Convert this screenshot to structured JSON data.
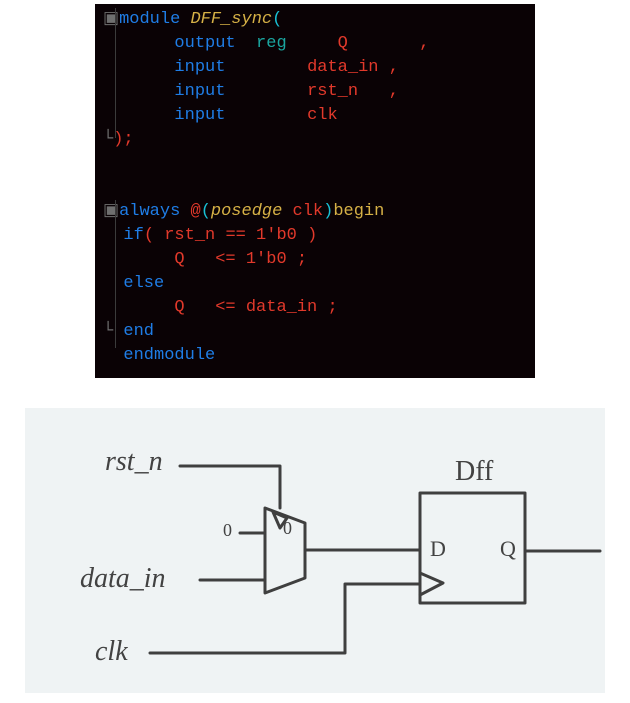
{
  "code": {
    "l1": {
      "kw": "module ",
      "name": "DFF_sync",
      "open": "("
    },
    "l2": {
      "dir": "output  ",
      "type": "reg",
      "sig": "Q",
      "comma": ","
    },
    "l3": {
      "dir": "input",
      "sig": "data_in ",
      "comma": ","
    },
    "l4": {
      "dir": "input",
      "sig": "rst_n",
      "comma": ","
    },
    "l5": {
      "dir": "input",
      "sig": "clk"
    },
    "l6": {
      "close": ");"
    },
    "l7": "",
    "l8": "",
    "l9": {
      "kw": "always ",
      "at": "@",
      "open": "(",
      "edge": "posedge ",
      "sig": "clk",
      "close": ")",
      "begin": "begin"
    },
    "l10": {
      "kw": "if",
      "open": "( ",
      "sig": "rst_n ",
      "op": "== ",
      "lit": "1'b0 ",
      "close": ")"
    },
    "l11": {
      "sig": "Q",
      "op": "<= ",
      "lit": "1'b0 ",
      "semi": ";"
    },
    "l12": {
      "kw": "else"
    },
    "l13": {
      "sig": "Q",
      "op": "<= ",
      "sig2": "data_in ",
      "semi": ";"
    },
    "l14": {
      "kw": "end"
    },
    "l15": {
      "kw": "endmodule"
    }
  },
  "diagram": {
    "rst_n": "rst_n",
    "data_in": "data_in",
    "clk": "clk",
    "zero": "0",
    "mux_zero": "0",
    "dff": "Dff",
    "d": "D",
    "q": "Q"
  }
}
